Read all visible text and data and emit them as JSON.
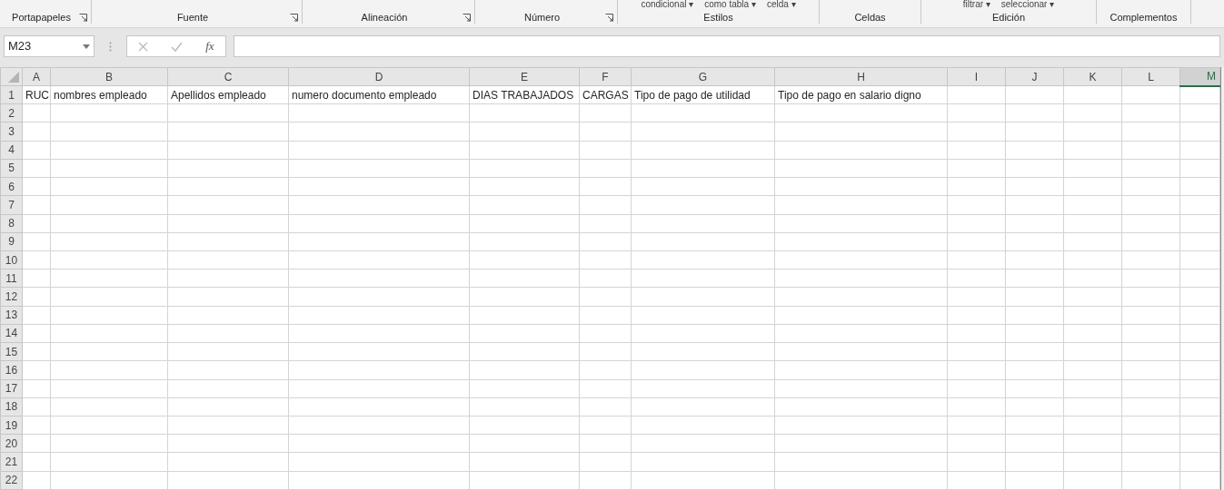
{
  "ribbon": {
    "groups": [
      {
        "label": "Portapapeles",
        "launcher": true
      },
      {
        "label": "Fuente",
        "launcher": true
      },
      {
        "label": "Alineación",
        "launcher": true
      },
      {
        "label": "Número",
        "launcher": true
      },
      {
        "label": "Estilos",
        "launcher": false,
        "items": [
          "condicional ▾",
          "como tabla ▾",
          "celda ▾"
        ]
      },
      {
        "label": "Celdas",
        "launcher": false
      },
      {
        "label": "Edición",
        "launcher": false,
        "items": [
          "filtrar ▾",
          "seleccionar ▾"
        ]
      },
      {
        "label": "Complementos",
        "launcher": false
      }
    ]
  },
  "name_box": "M23",
  "formula_bar": {
    "fx": "fx"
  },
  "columns": [
    {
      "label": "A",
      "selected": false
    },
    {
      "label": "B",
      "selected": false
    },
    {
      "label": "C",
      "selected": false
    },
    {
      "label": "D",
      "selected": false
    },
    {
      "label": "E",
      "selected": false
    },
    {
      "label": "F",
      "selected": false
    },
    {
      "label": "G",
      "selected": false
    },
    {
      "label": "H",
      "selected": false
    },
    {
      "label": "I",
      "selected": false
    },
    {
      "label": "J",
      "selected": false
    },
    {
      "label": "K",
      "selected": false
    },
    {
      "label": "L",
      "selected": false
    },
    {
      "label": "M",
      "selected": true
    }
  ],
  "rows": [
    {
      "label": "1",
      "cells": [
        "RUC",
        "nombres empleado",
        "Apellidos empleado",
        "numero documento empleado",
        "DIAS TRABAJADOS",
        "CARGAS",
        "Tipo de pago de utilidad",
        "Tipo de pago en salario digno"
      ]
    },
    {
      "label": "2",
      "cells": []
    },
    {
      "label": "3",
      "cells": []
    },
    {
      "label": "4",
      "cells": []
    },
    {
      "label": "5",
      "cells": []
    },
    {
      "label": "6",
      "cells": []
    },
    {
      "label": "7",
      "cells": []
    },
    {
      "label": "8",
      "cells": []
    },
    {
      "label": "9",
      "cells": []
    },
    {
      "label": "10",
      "cells": []
    },
    {
      "label": "11",
      "cells": []
    },
    {
      "label": "12",
      "cells": []
    },
    {
      "label": "13",
      "cells": []
    },
    {
      "label": "14",
      "cells": []
    },
    {
      "label": "15",
      "cells": []
    },
    {
      "label": "16",
      "cells": []
    },
    {
      "label": "17",
      "cells": []
    },
    {
      "label": "18",
      "cells": []
    },
    {
      "label": "19",
      "cells": []
    },
    {
      "label": "20",
      "cells": []
    },
    {
      "label": "21",
      "cells": []
    },
    {
      "label": "22",
      "cells": []
    }
  ]
}
